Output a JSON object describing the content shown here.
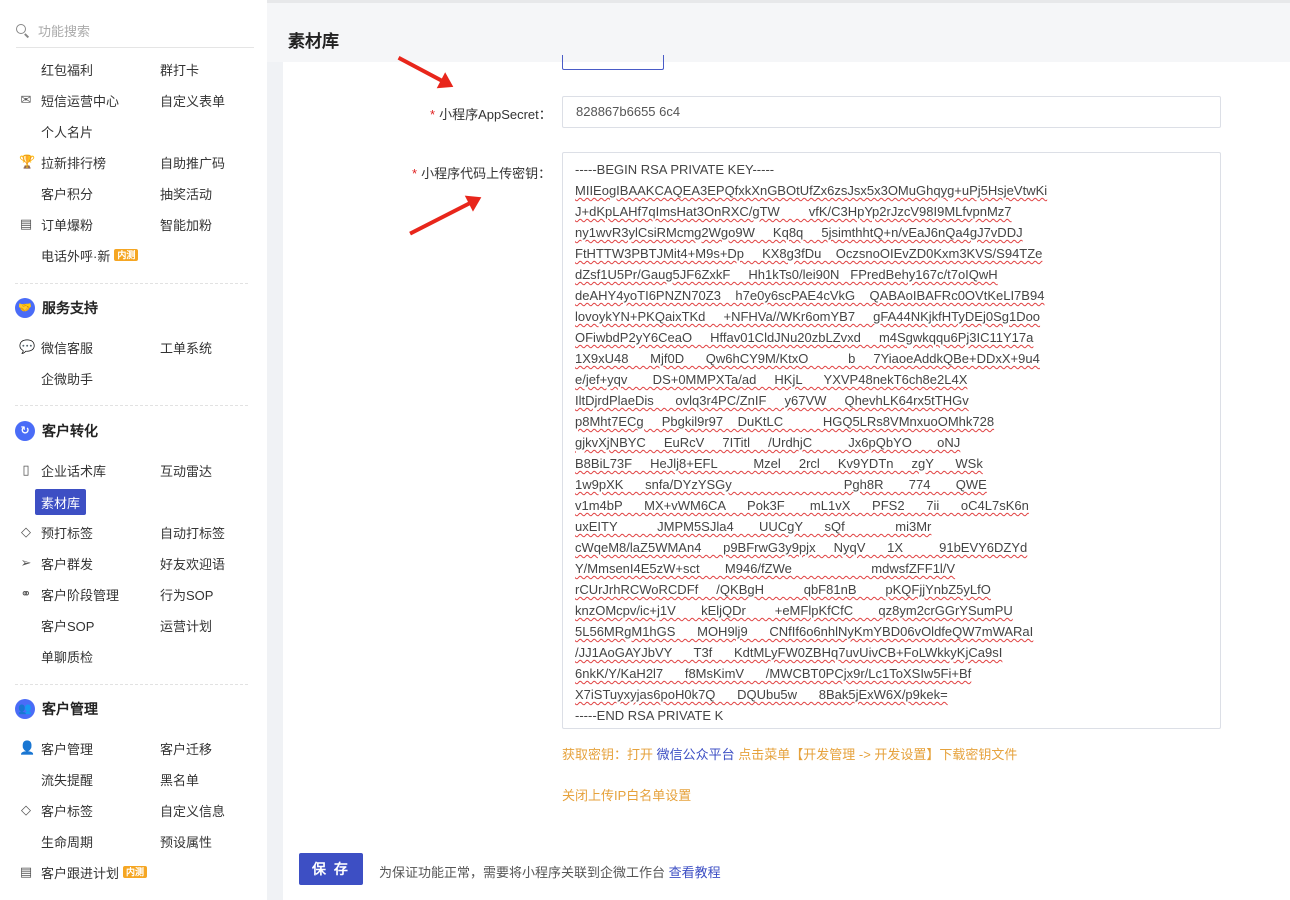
{
  "search": {
    "placeholder": "功能搜索"
  },
  "sidebar": {
    "rows": [
      {
        "c1": "红包福利",
        "c2": "群打卡"
      },
      {
        "icon": "✉",
        "icon_name": "mail-icon",
        "c1": "短信运营中心",
        "c2": "自定义表单"
      },
      {
        "c1": "个人名片",
        "c2": ""
      },
      {
        "icon": "🏆",
        "icon_name": "trophy-icon",
        "c1": "拉新排行榜",
        "c2": "自助推广码"
      },
      {
        "c1": "客户积分",
        "c2": "抽奖活动"
      },
      {
        "icon": "▤",
        "icon_name": "order-icon",
        "c1": "订单爆粉",
        "c2": "智能加粉"
      },
      {
        "c1": "电话外呼·新",
        "c2": "",
        "badge": "内测"
      }
    ],
    "service": {
      "title": "服务支持",
      "rows": [
        {
          "c1": "微信客服",
          "c2": "工单系统"
        },
        {
          "c1": "企微助手",
          "c2": ""
        }
      ]
    },
    "conversion": {
      "title": "客户转化",
      "rows": [
        {
          "c1": "企业话术库",
          "c2": "互动雷达"
        },
        {
          "c1": "素材库",
          "c2": ""
        },
        {
          "c1": "预打标签",
          "c2": "自动打标签"
        },
        {
          "c1": "客户群发",
          "c2": "好友欢迎语"
        },
        {
          "c1": "客户阶段管理",
          "c2": "行为SOP"
        },
        {
          "c1": "客户SOP",
          "c2": "运营计划"
        },
        {
          "c1": "单聊质检",
          "c2": ""
        }
      ]
    },
    "management": {
      "title": "客户管理",
      "rows": [
        {
          "c1": "客户管理",
          "c2": "客户迁移"
        },
        {
          "c1": "流失提醒",
          "c2": "黑名单"
        },
        {
          "c1": "客户标签",
          "c2": "自定义信息"
        },
        {
          "c1": "生命周期",
          "c2": "预设属性"
        },
        {
          "c1": "客户跟进计划",
          "c2": "",
          "badge": "内测"
        }
      ]
    }
  },
  "page": {
    "title": "素材库"
  },
  "form": {
    "secret_label": "小程序AppSecret：",
    "secret_value": "828867b6655                    6c4",
    "key_label": "小程序代码上传密钥：",
    "key_lines": [
      "-----BEGIN RSA PRIVATE KEY-----",
      "MIIEogIBAAKCAQEA3EPQfxkXnGBOtUfZx6zsJsx5x3OMuGhqyg+uPj5HsjeVtwKi",
      "J+dKpLAHf7qImsHat3OnRXC/gTW        vfK/C3HpYp2rJzcV98I9MLfvpnMz7",
      "ny1wvR3ylCsiRMcmg2Wgo9W     Kq8q     5jsimthhtQ+n/vEaJ6nQa4gJ7vDDJ",
      "FtHTTW3PBTJMit4+M9s+Dp     KX8g3fDu    OczsnoOIEvZD0Kxm3KVS/S94TZe",
      "dZsf1U5Pr/Gaug5JF6ZxkF     Hh1kTs0/lei90N   FPredBehy167c/t7oIQwH",
      "deAHY4yoTI6PNZN70Z3    h7e0y6scPAE4cVkG    QABAoIBAFRc0OVtKeLI7B94",
      "lovoykYN+PKQaixTKd     +NFHVa//WKr6omYB7     gFA44NKjkfHTyDEj0Sg1Doo",
      "OFiwbdP2yY6CeaO     Hffav01CldJNu20zbLZvxd     m4Sgwkqqu6Pj3IC11Y17a",
      "1X9xU48      Mjf0D      Qw6hCY9M/KtxO           b     7YiaoeAddkQBe+DDxX+9u4",
      "e/jef+yqv       DS+0MMPXTa/ad     HKjL      YXVP48nekT6ch8e2L4X",
      "IltDjrdPlaeDis      ovlq3r4PC/ZnIF     y67VW     QhevhLK64rx5tTHGv",
      "p8Mht7ECg     Pbgkil9r97    DuKtLC           HGQ5LRs8VMnxuoOMhk728",
      "gjkvXjNBYC     EuRcV     7ITitl     /UrdhjC          Jx6pQbYO       oNJ",
      "B8BiL73F     HeJlj8+EFL          Mzel     2rcl     Kv9YDTn     zgY      WSk",
      "1w9pXK      snfa/DYzYSGy                               Pgh8R       774       QWE",
      "v1m4bP      MX+vWM6CA      Pok3F       mL1vX      PFS2      7ii      oC4L7sK6n",
      "uxEITY           JMPM5SJla4       UUCgY      sQf              mi3Mr",
      "cWqeM8/laZ5WMAn4      p9BFrwG3y9pjx     NyqV      1X          91bEVY6DZYd",
      "Y/MmsenI4E5zW+sct       M946/fZWe                      mdwsfZFF1l/V",
      "rCUrJrhRCWoRCDFf     /QKBgH           qbF81nB        pKQFjjYnbZ5yLfO",
      "knzOMcpv/ic+j1V       kEljQDr        +eMFlpKfCfC       qz8ym2crGGrYSumPU",
      "5L56MRgM1hGS      MOH9lj9      CNfIf6o6nhlNyKmYBD06vOldfeQW7mWARaI",
      "/JJ1AoGAYJbVY      T3f      KdtMLyFW0ZBHq7uvUivCB+FoLWkkyKjCa9sI",
      "6nkK/Y/KaH2l7      f8MsKimV      /MWCBT0PCjx9r/Lc1ToXSIw5Fi+Bf",
      "X7iSTuyxyjas6poH0k7Q      DQUbu5w      8Bak5jExW6X/p9kek=",
      "-----END RSA PRIVATE K"
    ],
    "hint_prefix": "获取密钥：打开 ",
    "hint_link": "微信公众平台",
    "hint_suffix": " 点击菜单【开发管理 -> 开发设置】下载密钥文件",
    "ip_setting": "关闭上传IP白名单设置",
    "save_label": "保 存",
    "note_text": "为保证功能正常，需要将小程序关联到企微工作台 ",
    "note_link": "查看教程"
  },
  "colors": {
    "accent": "#3d4fc4",
    "warning": "#e6a23c",
    "required": "#e02020",
    "arrow": "#e8261b"
  }
}
